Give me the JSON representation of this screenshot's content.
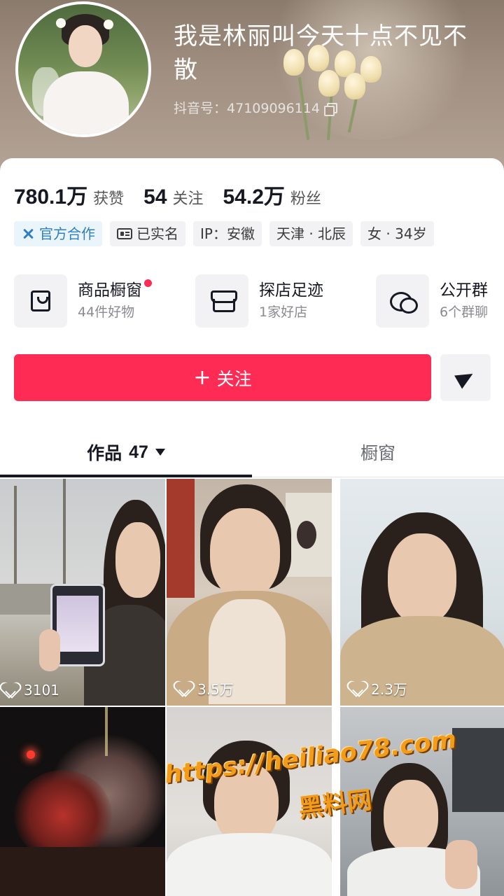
{
  "profile": {
    "nickname": "我是林丽叫今天十点不见不散",
    "account_label": "抖音号：",
    "account_id": "47109096114"
  },
  "stats": [
    {
      "value": "780.1万",
      "label": "获赞"
    },
    {
      "value": "54",
      "label": "关注"
    },
    {
      "value": "54.2万",
      "label": "粉丝"
    }
  ],
  "tags": {
    "official": "官方合作",
    "verified": "已实名",
    "ip": "IP：安徽",
    "location": "天津 · 北辰",
    "gender_age": "女 · 34岁"
  },
  "features": [
    {
      "title": "商品橱窗",
      "subtitle": "44件好物",
      "icon": "bag-icon",
      "has_badge": true
    },
    {
      "title": "探店足迹",
      "subtitle": "1家好店",
      "icon": "store-icon",
      "has_badge": false
    },
    {
      "title": "公开群",
      "subtitle": "6个群聊",
      "icon": "chat-icon",
      "has_badge": false
    }
  ],
  "actions": {
    "follow_icon": "+",
    "follow_label": "关注",
    "share_icon": "send-icon"
  },
  "tabs": {
    "works_label": "作品",
    "works_count": "47",
    "showcase_label": "橱窗"
  },
  "videos": [
    {
      "likes": "3101"
    },
    {
      "likes": "3.5万"
    },
    {
      "likes": "2.3万"
    },
    {
      "likes": ""
    },
    {
      "likes": ""
    },
    {
      "likes": ""
    }
  ],
  "watermark": {
    "url": "https://heiliao78.com",
    "name": "黑料网"
  },
  "colors": {
    "accent": "#fe2c55",
    "official_blue": "#2f7fc1",
    "watermark_orange": "#f39c1a"
  }
}
